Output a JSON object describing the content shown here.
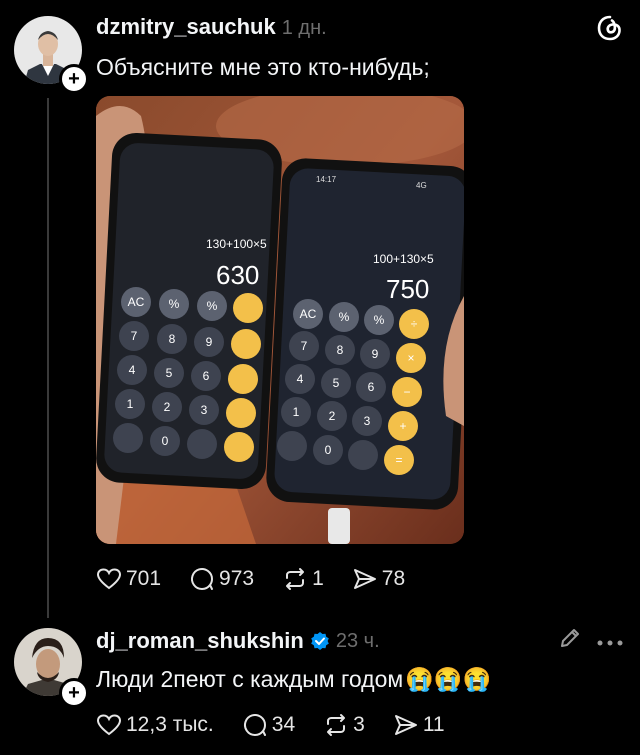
{
  "post": {
    "username": "dzmitry_sauchuk",
    "time": "1 дн.",
    "text": "Объясните мне это кто-нибудь;",
    "likes": "701",
    "comments": "973",
    "reposts": "1",
    "shares": "78",
    "calc_left": {
      "expr": "130+100×5",
      "result": "630"
    },
    "calc_right": {
      "expr": "100+130×5",
      "result": "750"
    }
  },
  "reply": {
    "username": "dj_roman_shukshin",
    "time": "23 ч.",
    "text": "Люди 2пеют с каждым годом",
    "emoji": "😭😭😭",
    "likes": "12,3 тыс.",
    "comments": "34",
    "reposts": "3",
    "shares": "11"
  },
  "calc_keys": [
    "AC",
    "%",
    "%",
    "7",
    "8",
    "9",
    "4",
    "5",
    "6",
    "1",
    "2",
    "3",
    "0",
    "÷",
    "×",
    "−",
    "+",
    "="
  ],
  "phone_time": "14:17",
  "phone_network": "4G",
  "icons": [
    "threads-logo-icon",
    "heart-icon",
    "comment-icon",
    "repost-icon",
    "share-icon",
    "edit-icon",
    "more-icon",
    "verified-badge-icon"
  ],
  "colors": {
    "background": "#000000",
    "text": "#f3f5f7",
    "muted": "#6e6e6e",
    "verified": "#0095f6",
    "calc_orange": "#f3c04a"
  }
}
